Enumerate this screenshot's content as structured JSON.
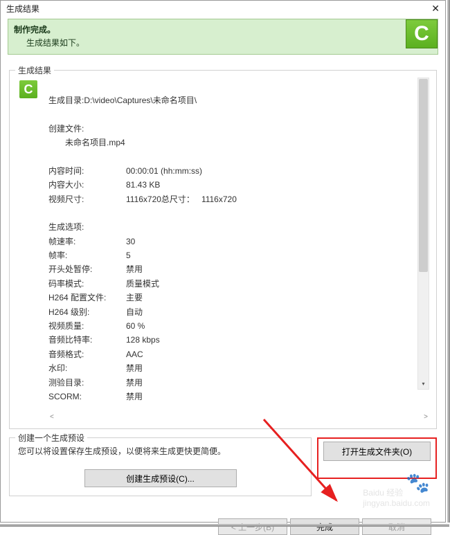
{
  "window": {
    "title": "生成结果"
  },
  "header": {
    "line1": "制作完成。",
    "line2": "生成结果如下。"
  },
  "results": {
    "legend": "生成结果",
    "directory_label": "生成目录:",
    "directory_value": "D:\\video\\Captures\\未命名项目\\",
    "created_file_label": "创建文件:",
    "created_file_value": "未命名项目.mp4",
    "content_time_label": "内容时间:",
    "content_time_value": "00:00:01 (hh:mm:ss)",
    "content_size_label": "内容大小:",
    "content_size_value": "81.43 KB",
    "video_dim_label": "视频尺寸:",
    "video_dim_value": "1116x720总尺寸：   1116x720",
    "gen_options": "生成选项:",
    "frame_rate_label": "帧速率:",
    "frame_rate_value": "30",
    "frames_label": "帧率:",
    "frames_value": "5",
    "pause_label": "开头处暂停:",
    "pause_value": "禁用",
    "bitrate_mode_label": "码率模式:",
    "bitrate_mode_value": "质量模式",
    "h264_profile_label": "H264 配置文件:",
    "h264_profile_value": "主要",
    "h264_level_label": "H264 级别:",
    "h264_level_value": "自动",
    "video_quality_label": "视频质量:",
    "video_quality_value": "60 %",
    "audio_bitrate_label": "音频比特率:",
    "audio_bitrate_value": "128 kbps",
    "audio_format_label": "音频格式:",
    "audio_format_value": "AAC",
    "watermark_label": "水印:",
    "watermark_value": "禁用",
    "test_dir_label": "测验目录:",
    "test_dir_value": "禁用",
    "scorm_label": "SCORM:",
    "scorm_value": "禁用"
  },
  "preset": {
    "legend": "创建一个生成预设",
    "desc": "您可以将设置保存生成预设，以便将来生成更快更简便。",
    "button": "创建生成预设(C)..."
  },
  "open_folder_button": "打开生成文件夹(O)",
  "footer": {
    "back": "< 上一步(B)",
    "finish": "完成",
    "cancel": "取消"
  },
  "watermark_text": "jingyan.baidu.com",
  "watermark_brand": "Baidu 经验"
}
